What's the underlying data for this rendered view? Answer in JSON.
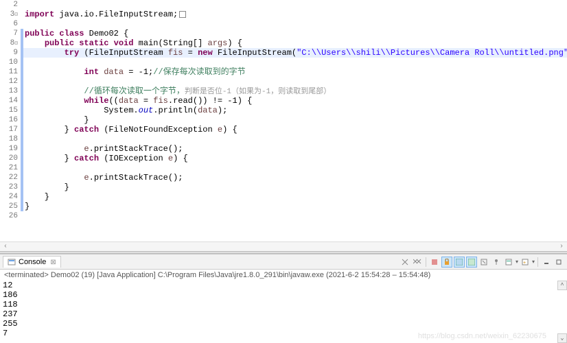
{
  "editor": {
    "lines": [
      {
        "n": "2",
        "txt": ""
      },
      {
        "n": "3",
        "mark": true,
        "tokens": [
          [
            "kw",
            "import"
          ],
          [
            "plain",
            " java.io.FileInputStream;"
          ]
        ],
        "suffix_fold": true
      },
      {
        "n": "6",
        "txt": ""
      },
      {
        "n": "7",
        "tokens": [
          [
            "kw",
            "public"
          ],
          [
            "plain",
            " "
          ],
          [
            "kw",
            "class"
          ],
          [
            "plain",
            " "
          ],
          [
            "type",
            "Demo02"
          ],
          [
            "plain",
            " {"
          ]
        ]
      },
      {
        "n": "8",
        "mark": true,
        "tokens": [
          [
            "plain",
            "    "
          ],
          [
            "kw",
            "public"
          ],
          [
            "plain",
            " "
          ],
          [
            "kw",
            "static"
          ],
          [
            "plain",
            " "
          ],
          [
            "kw",
            "void"
          ],
          [
            "plain",
            " "
          ],
          [
            "type",
            "main"
          ],
          [
            "plain",
            "(String[] "
          ],
          [
            "var",
            "args"
          ],
          [
            "plain",
            ") {"
          ]
        ]
      },
      {
        "n": "9",
        "hl": true,
        "tokens": [
          [
            "plain",
            "        "
          ],
          [
            "kw",
            "try"
          ],
          [
            "plain",
            " (FileInputStream "
          ],
          [
            "var",
            "fis"
          ],
          [
            "plain",
            " = "
          ],
          [
            "kw",
            "new"
          ],
          [
            "plain",
            " FileInputStream("
          ],
          [
            "str",
            "\"C:\\\\Users\\\\shili\\\\Pictures\\\\Camera Roll\\\\untitled.png\""
          ],
          [
            "plain",
            ")){"
          ]
        ]
      },
      {
        "n": "10",
        "txt": ""
      },
      {
        "n": "11",
        "tokens": [
          [
            "plain",
            "            "
          ],
          [
            "kw",
            "int"
          ],
          [
            "plain",
            " "
          ],
          [
            "var",
            "data"
          ],
          [
            "plain",
            " = -1;"
          ],
          [
            "cmt",
            "//保存每次读取到的字节"
          ]
        ]
      },
      {
        "n": "12",
        "txt": ""
      },
      {
        "n": "13",
        "tokens": [
          [
            "plain",
            "            "
          ],
          [
            "cmt",
            "//循环每次读取一个字节，"
          ],
          [
            "dim-cmt",
            "判断是否位-1（如果为-1，则读取到尾部）"
          ]
        ]
      },
      {
        "n": "14",
        "tokens": [
          [
            "plain",
            "            "
          ],
          [
            "kw",
            "while"
          ],
          [
            "plain",
            "(("
          ],
          [
            "var",
            "data"
          ],
          [
            "plain",
            " = "
          ],
          [
            "var",
            "fis"
          ],
          [
            "plain",
            ".read()) != -1) {"
          ]
        ]
      },
      {
        "n": "15",
        "tokens": [
          [
            "plain",
            "                System."
          ],
          [
            "field",
            "out"
          ],
          [
            "plain",
            ".println("
          ],
          [
            "var",
            "data"
          ],
          [
            "plain",
            ");"
          ]
        ]
      },
      {
        "n": "16",
        "tokens": [
          [
            "plain",
            "            }"
          ]
        ]
      },
      {
        "n": "17",
        "tokens": [
          [
            "plain",
            "        } "
          ],
          [
            "kw",
            "catch"
          ],
          [
            "plain",
            " (FileNotFoundException "
          ],
          [
            "var",
            "e"
          ],
          [
            "plain",
            ") {"
          ]
        ]
      },
      {
        "n": "18",
        "txt": ""
      },
      {
        "n": "19",
        "tokens": [
          [
            "plain",
            "            "
          ],
          [
            "var",
            "e"
          ],
          [
            "plain",
            ".printStackTrace();"
          ]
        ]
      },
      {
        "n": "20",
        "tokens": [
          [
            "plain",
            "        } "
          ],
          [
            "kw",
            "catch"
          ],
          [
            "plain",
            " (IOException "
          ],
          [
            "var",
            "e"
          ],
          [
            "plain",
            ") {"
          ]
        ]
      },
      {
        "n": "21",
        "txt": ""
      },
      {
        "n": "22",
        "tokens": [
          [
            "plain",
            "            "
          ],
          [
            "var",
            "e"
          ],
          [
            "plain",
            ".printStackTrace();"
          ]
        ]
      },
      {
        "n": "23",
        "tokens": [
          [
            "plain",
            "        }"
          ]
        ]
      },
      {
        "n": "24",
        "tokens": [
          [
            "plain",
            "    }"
          ]
        ]
      },
      {
        "n": "25",
        "tokens": [
          [
            "plain",
            "}"
          ]
        ]
      },
      {
        "n": "26",
        "txt": ""
      }
    ]
  },
  "console": {
    "tab_label": "Console",
    "status": "<terminated> Demo02 (19) [Java Application] C:\\Program Files\\Java\\jre1.8.0_291\\bin\\javaw.exe  (2021-6-2 15:54:28 – 15:54:48)",
    "output": [
      "12",
      "186",
      "118",
      "237",
      "255",
      "7"
    ],
    "toolbar": {
      "remove_launch": "x",
      "remove_all": "xx",
      "terminate": "■",
      "scroll_lock": "🔒",
      "show_console": "📋",
      "pin": "📌",
      "display": "▤",
      "open": "▢",
      "minimize": "−",
      "maximize": "□"
    }
  },
  "watermark": "https://blog.csdn.net/weixin_62230675"
}
